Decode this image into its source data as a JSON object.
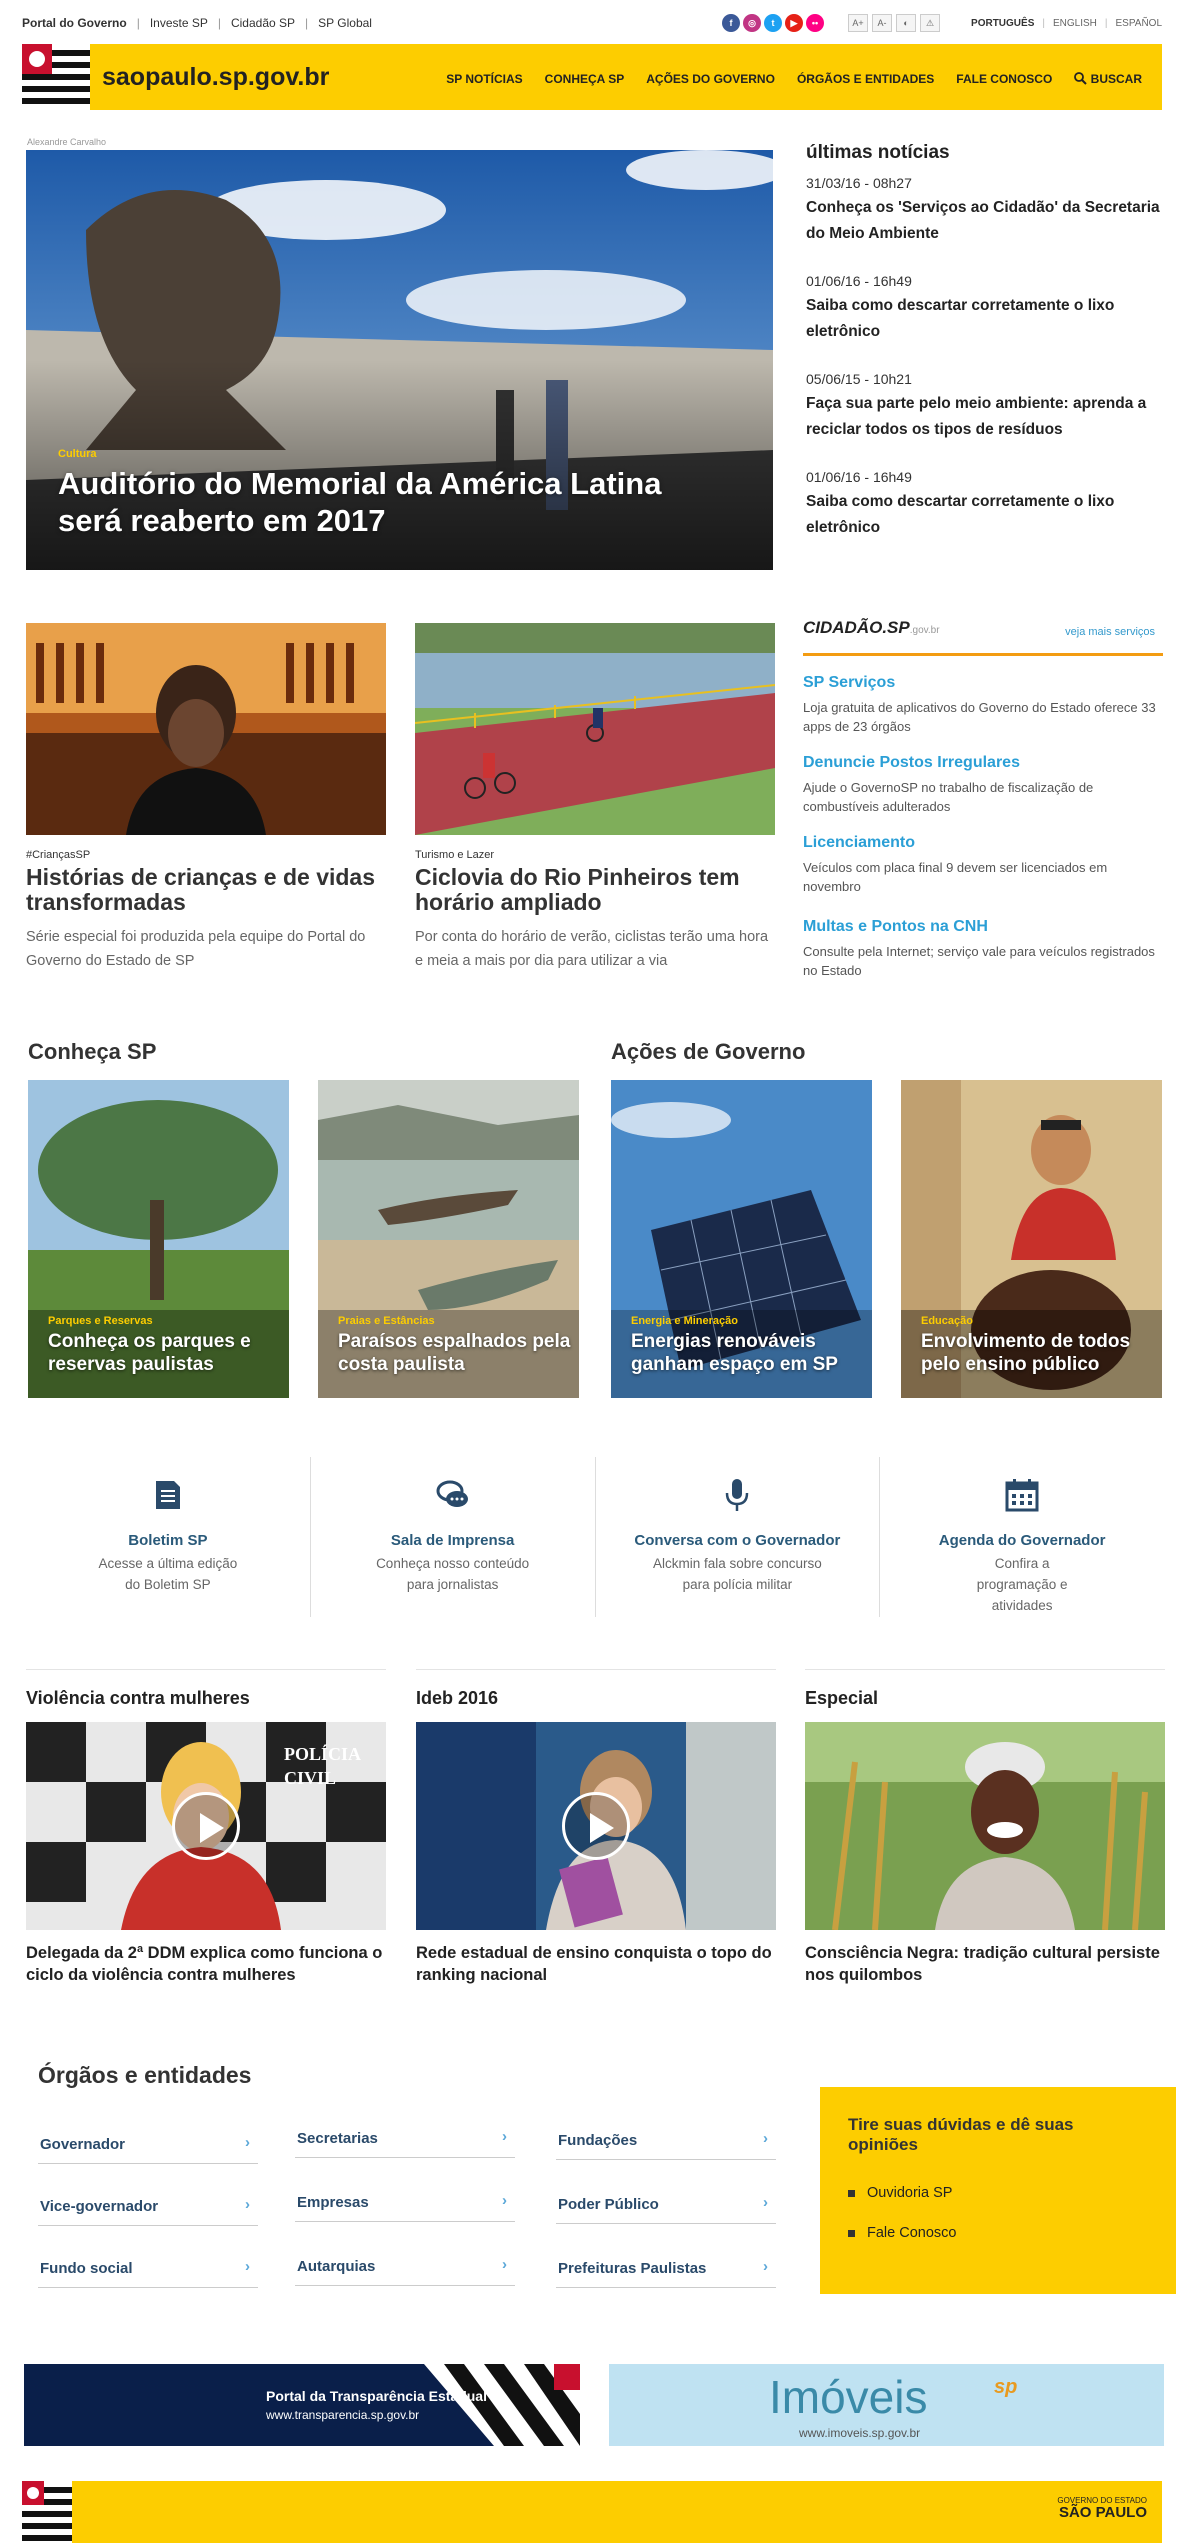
{
  "topbar": {
    "portals": [
      "Portal do Governo",
      "Investe SP",
      "Cidadão SP",
      "SP Global"
    ],
    "separator": "|",
    "social": [
      {
        "icon": "facebook-icon",
        "glyph": "f",
        "color": "#3b5998"
      },
      {
        "icon": "instagram-icon",
        "glyph": "◎",
        "color": "#c13584"
      },
      {
        "icon": "twitter-icon",
        "glyph": "t",
        "color": "#1da1f2"
      },
      {
        "icon": "youtube-icon",
        "glyph": "▶",
        "color": "#e62117"
      },
      {
        "icon": "flickr-icon",
        "glyph": "••",
        "color": "#ff0084"
      }
    ],
    "a11y": [
      "A+",
      "A-",
      "◐",
      "⚠"
    ],
    "languages": [
      "PORTUGUÊS",
      "ENGLISH",
      "ESPAÑOL"
    ]
  },
  "header": {
    "site_name": "saopaulo.sp.gov.br",
    "nav": [
      "SP NOTÍCIAS",
      "CONHEÇA SP",
      "AÇÕES DO GOVERNO",
      "ÓRGÃOS E ENTIDADES",
      "FALE CONOSCO"
    ],
    "search_label": "BUSCAR",
    "brand_color": "#fdcd00"
  },
  "hero": {
    "photo_credit": "Alexandre Carvalho",
    "category": "Cultura",
    "title": "Auditório do Memorial da América Latina será reaberto em 2017"
  },
  "latest": {
    "heading": "últimas notícias",
    "items": [
      {
        "date": "31/03/16 - 08h27",
        "title": "Conheça os 'Serviços ao Cidadão' da Secretaria do Meio Ambiente"
      },
      {
        "date": "01/06/16 - 16h49",
        "title": "Saiba como descartar corretamente o lixo eletrônico"
      },
      {
        "date": "05/06/15 - 10h21",
        "title": "Faça sua parte pelo meio ambiente: aprenda a reciclar todos os tipos de resíduos"
      },
      {
        "date": "01/06/16 - 16h49",
        "title": "Saiba como descartar corretamente o lixo eletrônico"
      }
    ]
  },
  "cards": [
    {
      "category": "#CriançasSP",
      "title": "Histórias de crianças e de vidas transformadas",
      "desc": "Série especial foi produzida pela equipe do Portal do Governo do Estado de SP"
    },
    {
      "category": "Turismo e Lazer",
      "title": "Ciclovia do Rio Pinheiros tem horário ampliado",
      "desc": "Por conta do horário de verão, ciclistas terão uma hora e meia a mais por dia para utilizar a via"
    }
  ],
  "cidadao": {
    "brand": "CIDADÃO.SP",
    "brand_suffix": ".gov.br",
    "more_link": "veja mais serviços",
    "services": [
      {
        "name": "SP Serviços",
        "desc": "Loja gratuita de aplicativos do Governo do Estado oferece 33 apps de 23 órgãos"
      },
      {
        "name": "Denuncie Postos Irregulares",
        "desc": "Ajude o GovernoSP no trabalho de fiscalização de combustíveis adulterados"
      },
      {
        "name": "Licenciamento",
        "desc": "Veículos com placa final 9 devem ser licenciados em novembro"
      },
      {
        "name": "Multas e Pontos na CNH",
        "desc": "Consulte pela Internet; serviço vale para veículos registrados no Estado"
      }
    ]
  },
  "conheca": {
    "title": "Conheça SP",
    "tiles": [
      {
        "category": "Parques e Reservas",
        "title": "Conheça os parques e reservas paulistas"
      },
      {
        "category": "Praias e Estâncias",
        "title": "Paraísos espalhados pela costa paulista"
      }
    ]
  },
  "acoes": {
    "title": "Ações de Governo",
    "tiles": [
      {
        "category": "Energia e Mineração",
        "title": "Energias renováveis ganham espaço em SP"
      },
      {
        "category": "Educação",
        "title": "Envolvimento de todos pelo ensino público"
      }
    ]
  },
  "tools": [
    {
      "icon": "newsletter-icon",
      "name": "Boletim SP",
      "desc": "Acesse a última edição do Boletim SP"
    },
    {
      "icon": "chat-bubbles-icon",
      "name": "Sala de Imprensa",
      "desc": "Conheça nosso conteúdo para jornalistas"
    },
    {
      "icon": "microphone-icon",
      "name": "Conversa com o Governador",
      "desc": "Alckmin fala sobre concurso para polícia militar"
    },
    {
      "icon": "calendar-icon",
      "name": "Agenda do Governador",
      "desc": "Confira a programação e atividades"
    }
  ],
  "videos": [
    {
      "heading": "Violência contra mulheres",
      "title": "Delegada da 2ª DDM explica como funciona o ciclo da violência contra mulheres",
      "wall_text": "POLÍCIA CIVIL"
    },
    {
      "heading": "Ideb 2016",
      "title": "Rede estadual de ensino conquista o topo do ranking nacional"
    },
    {
      "heading": "Especial",
      "title": "Consciência Negra: tradição cultural persiste nos quilombos"
    }
  ],
  "orgs": {
    "title": "Órgãos e entidades",
    "columns": [
      [
        "Governador",
        "Vice-governador",
        "Fundo social"
      ],
      [
        "Secretarias",
        "Empresas",
        "Autarquias"
      ],
      [
        "Fundações",
        "Poder Público",
        "Prefeituras Paulistas"
      ]
    ],
    "chevron": "›"
  },
  "duvidas": {
    "title": "Tire suas dúvidas e dê suas opiniões",
    "links": [
      "Ouvidoria SP",
      "Fale Conosco"
    ]
  },
  "banners": {
    "transparencia_title": "Portal da Transparência Estadual",
    "transparencia_url": "www.transparencia.sp.gov.br",
    "imoveis_title": "Imóveis",
    "imoveis_badge": "sp",
    "imoveis_url": "www.imoveis.sp.gov.br"
  },
  "footer": {
    "gov_line": "GOVERNO DO ESTADO",
    "gov_name": "SÃO PAULO"
  }
}
